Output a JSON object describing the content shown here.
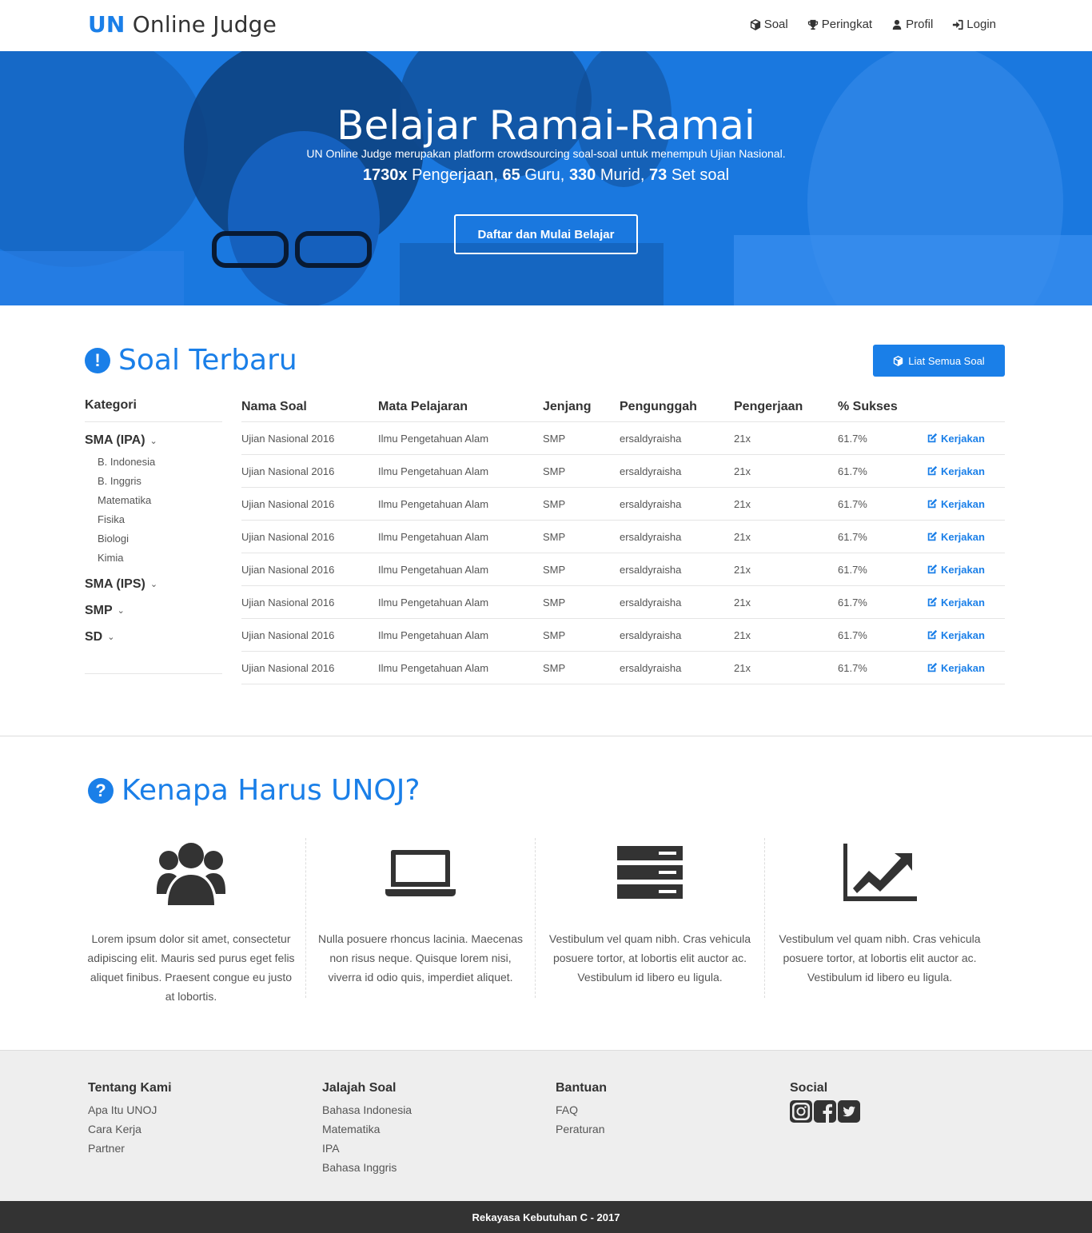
{
  "brand": {
    "prefix": "UN",
    "suffix": "Online Judge"
  },
  "nav": [
    {
      "label": "Soal",
      "icon": "cube-icon"
    },
    {
      "label": "Peringkat",
      "icon": "trophy-icon"
    },
    {
      "label": "Profil",
      "icon": "user-icon"
    },
    {
      "label": "Login",
      "icon": "sign-in-icon"
    }
  ],
  "hero": {
    "title": "Belajar Ramai-Ramai",
    "subtitle": "UN Online Judge merupakan platform crowdsourcing soal-soal untuk menempuh Ujian Nasional.",
    "stats": {
      "attempts": "1730x",
      "attempts_label": "Pengerjaan,",
      "teachers": "65",
      "teachers_label": "Guru,",
      "students": "330",
      "students_label": "Murid,",
      "sets": "73",
      "sets_label": "Set soal"
    },
    "cta": "Daftar dan Mulai Belajar"
  },
  "soal": {
    "title": "Soal Terbaru",
    "all_button": "Liat Semua Soal",
    "sidebar": {
      "heading": "Kategori",
      "categories": [
        {
          "label": "SMA (IPA)",
          "items": [
            "B. Indonesia",
            "B. Inggris",
            "Matematika",
            "Fisika",
            "Biologi",
            "Kimia"
          ]
        },
        {
          "label": "SMA (IPS)"
        },
        {
          "label": "SMP"
        },
        {
          "label": "SD"
        }
      ]
    },
    "headers": [
      "Nama Soal",
      "Mata Pelajaran",
      "Jenjang",
      "Pengunggah",
      "Pengerjaan",
      "% Sukses"
    ],
    "action_label": "Kerjakan",
    "rows": [
      [
        "Ujian Nasional 2016",
        "Ilmu Pengetahuan Alam",
        "SMP",
        "ersaldyraisha",
        "21x",
        "61.7%"
      ],
      [
        "Ujian Nasional 2016",
        "Ilmu Pengetahuan Alam",
        "SMP",
        "ersaldyraisha",
        "21x",
        "61.7%"
      ],
      [
        "Ujian Nasional 2016",
        "Ilmu Pengetahuan Alam",
        "SMP",
        "ersaldyraisha",
        "21x",
        "61.7%"
      ],
      [
        "Ujian Nasional 2016",
        "Ilmu Pengetahuan Alam",
        "SMP",
        "ersaldyraisha",
        "21x",
        "61.7%"
      ],
      [
        "Ujian Nasional 2016",
        "Ilmu Pengetahuan Alam",
        "SMP",
        "ersaldyraisha",
        "21x",
        "61.7%"
      ],
      [
        "Ujian Nasional 2016",
        "Ilmu Pengetahuan Alam",
        "SMP",
        "ersaldyraisha",
        "21x",
        "61.7%"
      ],
      [
        "Ujian Nasional 2016",
        "Ilmu Pengetahuan Alam",
        "SMP",
        "ersaldyraisha",
        "21x",
        "61.7%"
      ],
      [
        "Ujian Nasional 2016",
        "Ilmu Pengetahuan Alam",
        "SMP",
        "ersaldyraisha",
        "21x",
        "61.7%"
      ]
    ]
  },
  "why": {
    "title": "Kenapa Harus UNOJ?",
    "features": [
      {
        "icon": "users-icon",
        "text": "Lorem ipsum dolor sit amet, consectetur adipiscing elit. Mauris sed purus eget felis aliquet finibus. Praesent congue eu justo at lobortis."
      },
      {
        "icon": "laptop-icon",
        "text": "Nulla posuere rhoncus lacinia. Maecenas non risus neque. Quisque lorem nisi, viverra id odio quis, imperdiet aliquet."
      },
      {
        "icon": "server-icon",
        "text": "Vestibulum vel quam nibh. Cras vehicula posuere tortor, at lobortis elit auctor ac. Vestibulum id libero eu ligula."
      },
      {
        "icon": "line-chart-icon",
        "text": "Vestibulum vel quam nibh. Cras vehicula posuere tortor, at lobortis elit auctor ac. Vestibulum id libero eu ligula."
      }
    ]
  },
  "footer": {
    "columns": [
      {
        "heading": "Tentang Kami",
        "links": [
          "Apa Itu UNOJ",
          "Cara Kerja",
          "Partner"
        ]
      },
      {
        "heading": "Jalajah Soal",
        "links": [
          "Bahasa Indonesia",
          "Matematika",
          "IPA",
          "Bahasa Inggris"
        ]
      },
      {
        "heading": "Bantuan",
        "links": [
          "FAQ",
          "Peraturan"
        ]
      },
      {
        "heading": "Social",
        "links": []
      }
    ],
    "social": [
      "instagram-icon",
      "facebook-icon",
      "twitter-icon"
    ],
    "copyright": "Rekayasa Kebutuhan C - 2017"
  },
  "colors": {
    "accent": "#1a7fe8",
    "hero": "#1a78df",
    "dark": "#333333"
  }
}
